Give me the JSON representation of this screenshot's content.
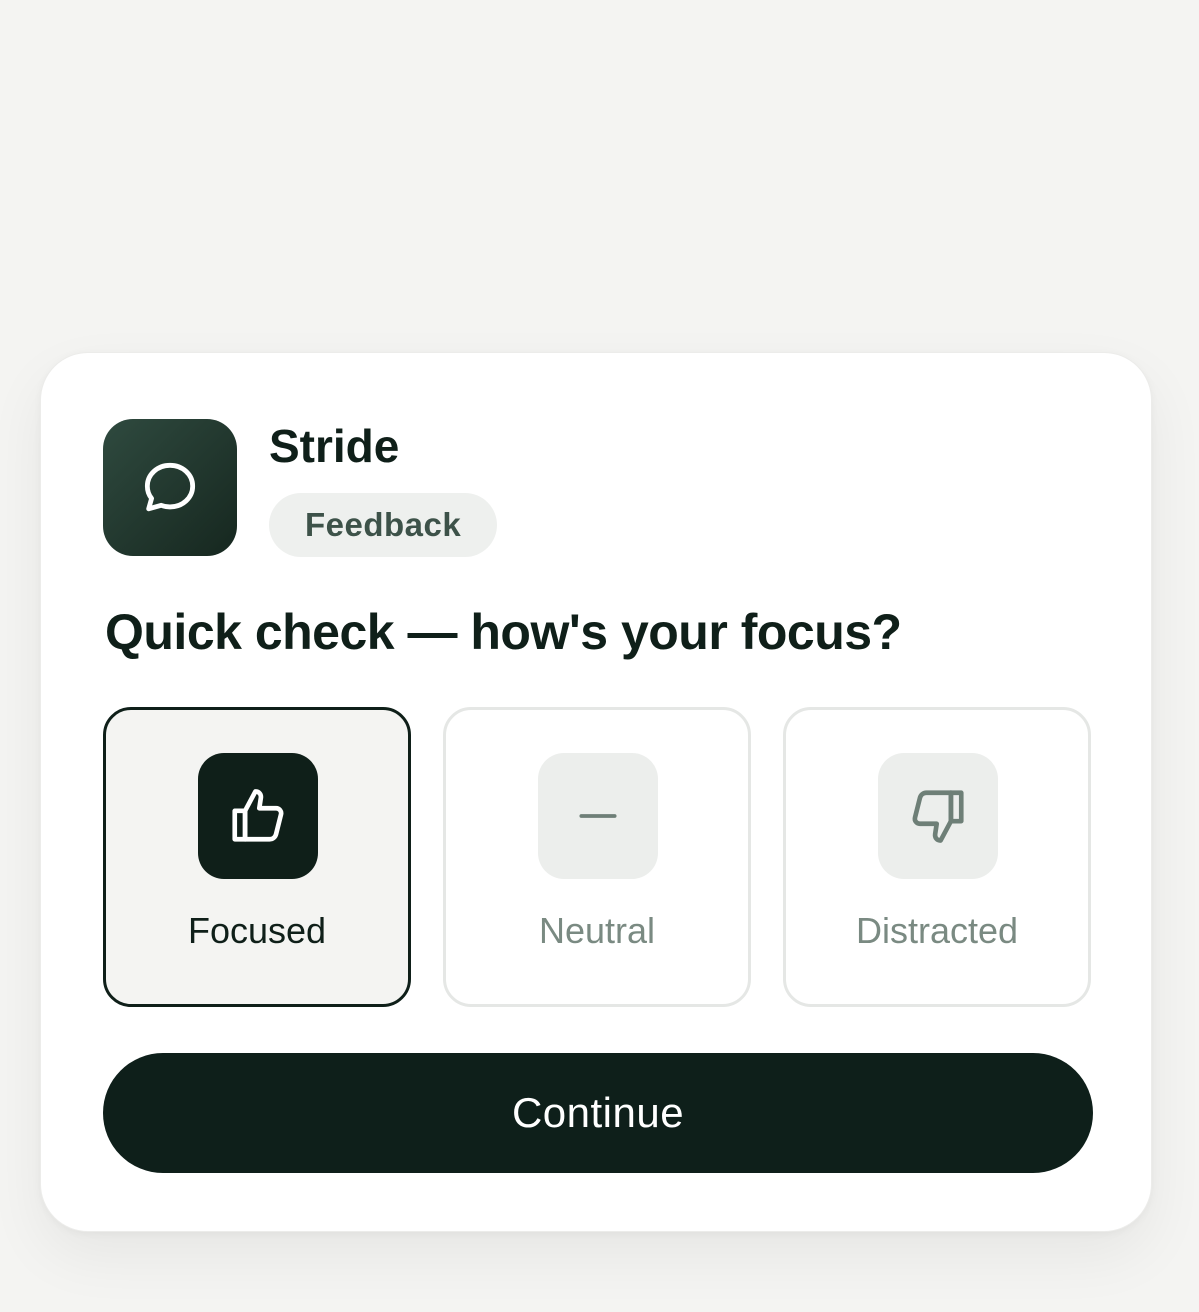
{
  "app": {
    "name": "Stride",
    "tag": "Feedback",
    "icon": "chat-bubble-icon"
  },
  "question": "Quick check — how's your focus?",
  "options": [
    {
      "label": "Focused",
      "icon": "thumbs-up-icon",
      "selected": true
    },
    {
      "label": "Neutral",
      "icon": "dash-icon",
      "selected": false
    },
    {
      "label": "Distracted",
      "icon": "thumbs-down-icon",
      "selected": false
    }
  ],
  "continue_label": "Continue",
  "colors": {
    "accent": "#0e1f1a",
    "background": "#f4f4f2",
    "card": "#ffffff",
    "muted_text": "#7a8a82"
  }
}
